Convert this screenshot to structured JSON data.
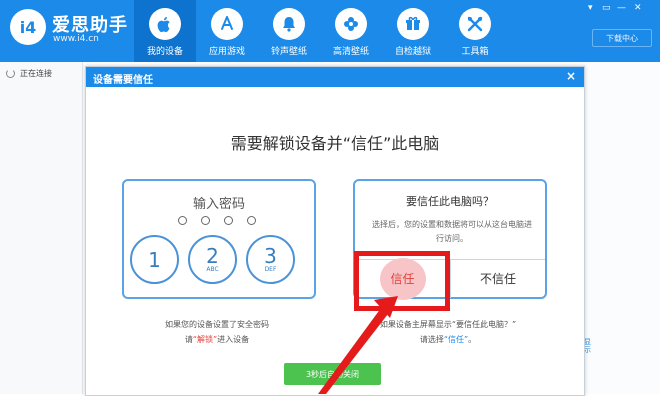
{
  "app": {
    "logo_text": "i4",
    "brand_name": "爱思助手",
    "brand_url": "www.i4.cn"
  },
  "nav": {
    "items": [
      {
        "label": "我的设备",
        "icon": "apple-icon",
        "active": true
      },
      {
        "label": "应用游戏",
        "icon": "app-store-icon",
        "active": false
      },
      {
        "label": "铃声壁纸",
        "icon": "bell-icon",
        "active": false
      },
      {
        "label": "高清壁纸",
        "icon": "flower-icon",
        "active": false
      },
      {
        "label": "自检越狱",
        "icon": "box-icon",
        "active": false
      },
      {
        "label": "工具箱",
        "icon": "tools-icon",
        "active": false
      }
    ]
  },
  "window_controls": [
    "▾",
    "▭",
    "—",
    "✕"
  ],
  "download_button": "下载中心",
  "sidebar": {
    "status": "正在连接"
  },
  "right_edge_text": "显示",
  "dialog": {
    "title": "设备需要信任",
    "close_glyph": "×",
    "headline": "需要解锁设备并“信任”此电脑",
    "pin_panel": {
      "title": "输入密码",
      "keys": [
        {
          "num": "1",
          "sub": ""
        },
        {
          "num": "2",
          "sub": "ABC"
        },
        {
          "num": "3",
          "sub": "DEF"
        }
      ]
    },
    "trust_panel": {
      "question": "要信任此电脑吗？",
      "description": "选择后，您的设置和数据将可以从这台电脑进行访问。",
      "trust_button": "信任",
      "distrust_button": "不信任"
    },
    "left_note": {
      "line1": "如果您的设备设置了安全密码",
      "line2_prefix": "请",
      "line2_highlight": "“解锁”",
      "line2_suffix": "进入设备"
    },
    "right_note": {
      "line1": "如果设备主屏幕显示“要信任此电脑？”",
      "line2_prefix": "请选择",
      "line2_highlight": "“信任”",
      "line2_suffix": "。"
    },
    "close_button": "3秒后自动关闭"
  },
  "colors": {
    "brand_blue": "#1c8ae8",
    "highlight_red": "#e51b1b",
    "close_green": "#4cc34f"
  }
}
